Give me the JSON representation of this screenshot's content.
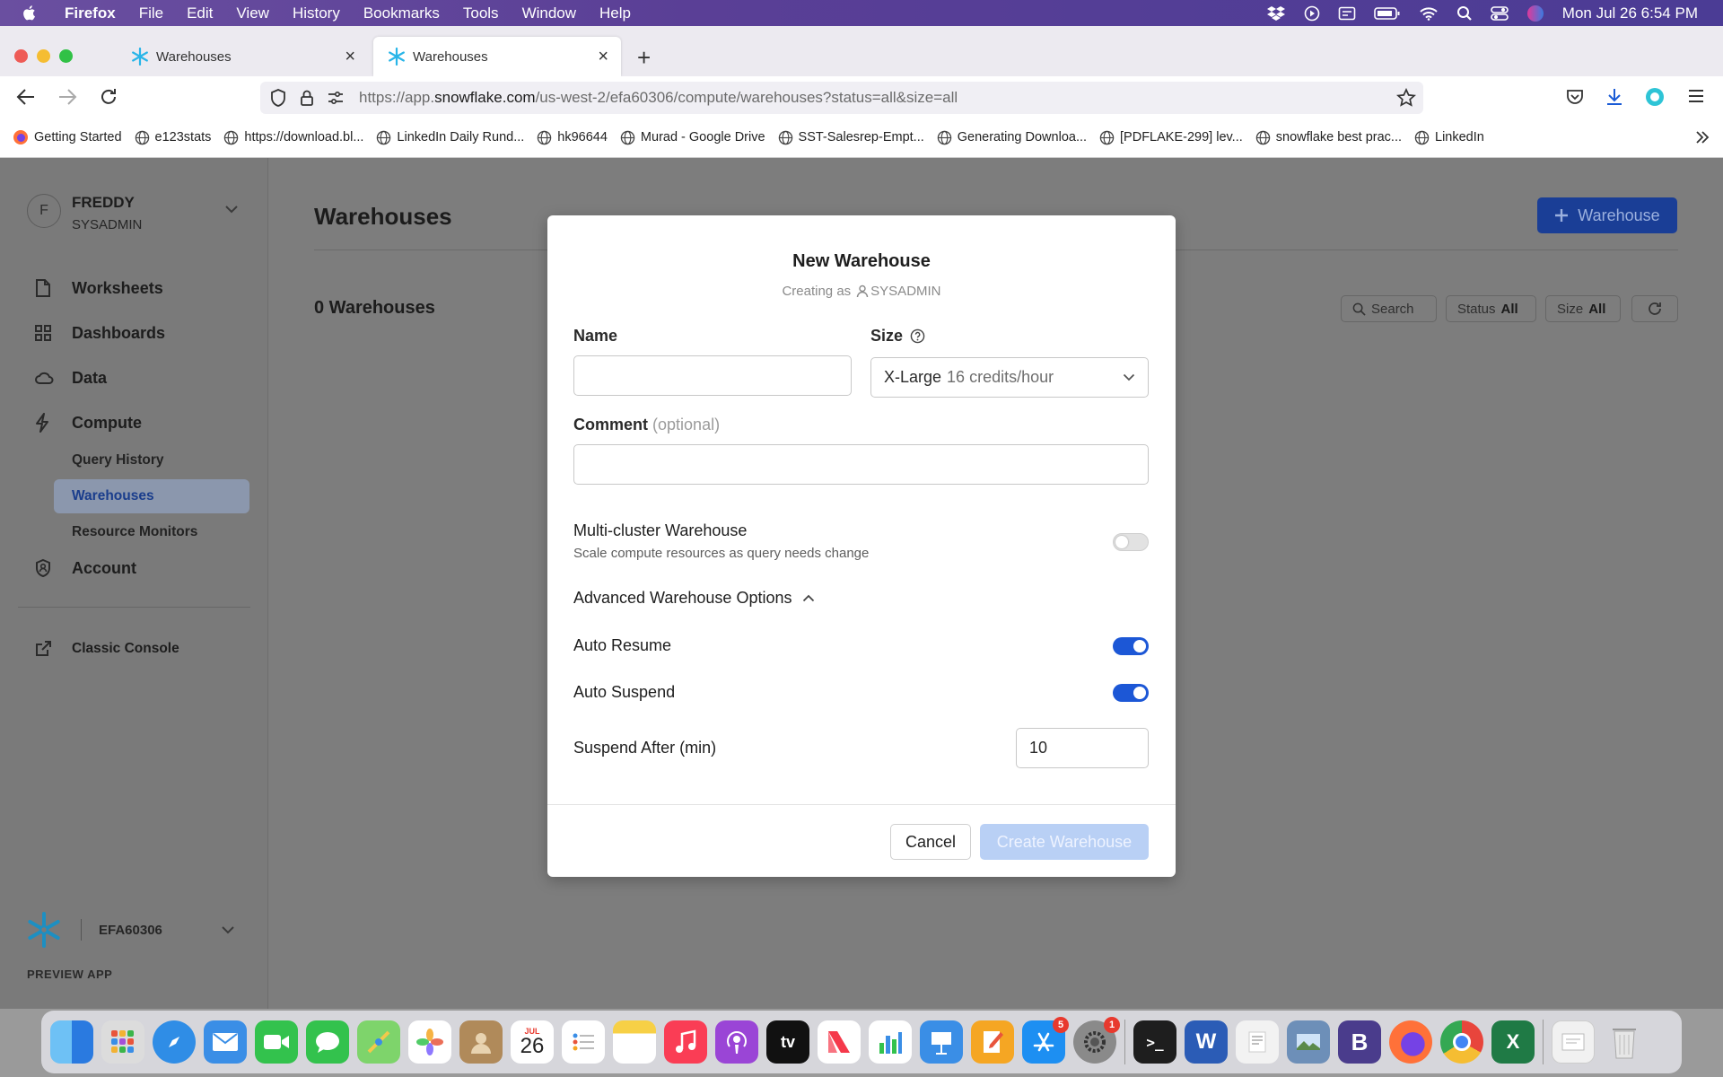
{
  "menubar": {
    "app_name": "Firefox",
    "items": [
      "File",
      "Edit",
      "View",
      "History",
      "Bookmarks",
      "Tools",
      "Window",
      "Help"
    ],
    "clock": "Mon Jul 26  6:54 PM"
  },
  "browser": {
    "tabs": [
      {
        "title": "Warehouses"
      },
      {
        "title": "Warehouses"
      }
    ],
    "url_prefix": "https://app.",
    "url_domain": "snowflake.com",
    "url_path": "/us-west-2/efa60306/compute/warehouses?status=all&size=all",
    "bookmarks": [
      "Getting Started",
      "e123stats",
      "https://download.bl...",
      "LinkedIn Daily Rund...",
      "hk96644",
      "Murad - Google Drive",
      "SST-Salesrep-Empt...",
      "Generating Downloa...",
      "[PDFLAKE-299] lev...",
      "snowflake best prac...",
      "LinkedIn"
    ]
  },
  "sidebar": {
    "avatar_letter": "F",
    "user_name": "FREDDY",
    "user_role": "SYSADMIN",
    "nav": {
      "worksheets": "Worksheets",
      "dashboards": "Dashboards",
      "data": "Data",
      "compute": "Compute",
      "query_history": "Query History",
      "warehouses": "Warehouses",
      "resource_monitors": "Resource Monitors",
      "account": "Account",
      "classic_console": "Classic Console"
    },
    "account_name": "EFA60306",
    "preview_label": "PREVIEW APP"
  },
  "main": {
    "title": "Warehouses",
    "add_button": "Warehouse",
    "count_label": "0 Warehouses",
    "search_label": "Search",
    "status_label": "Status",
    "status_value": "All",
    "size_label": "Size",
    "size_value": "All"
  },
  "modal": {
    "title": "New Warehouse",
    "creating_as": "Creating as",
    "role": "SYSADMIN",
    "name_label": "Name",
    "name_value": "",
    "size_label": "Size",
    "size_value": "X-Large",
    "size_credits": "16 credits/hour",
    "comment_label": "Comment",
    "comment_optional": "(optional)",
    "comment_value": "",
    "multicluster_label": "Multi-cluster Warehouse",
    "multicluster_desc": "Scale compute resources as query needs change",
    "advanced_label": "Advanced Warehouse Options",
    "auto_resume_label": "Auto Resume",
    "auto_suspend_label": "Auto Suspend",
    "suspend_after_label": "Suspend After (min)",
    "suspend_after_value": "10",
    "cancel_label": "Cancel",
    "create_label": "Create Warehouse"
  },
  "dock": {
    "calendar_month": "JUL",
    "calendar_day": "26",
    "appstore_badge": "5",
    "settings_badge": "1",
    "tv_label": "tv"
  },
  "colors": {
    "primary": "#1c57d6",
    "button_dark": "#1a3e96",
    "create_disabled": "#b9d0f5",
    "active_nav": "#8b97ad"
  }
}
